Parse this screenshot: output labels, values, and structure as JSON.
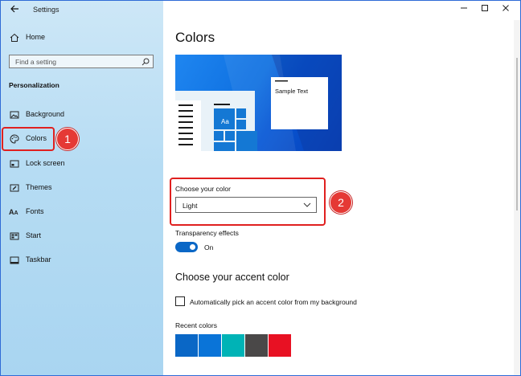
{
  "window": {
    "title": "Settings",
    "back_icon": "arrow-left-icon",
    "minimize_icon": "minimize-icon",
    "maximize_icon": "maximize-icon",
    "close_icon": "close-icon"
  },
  "sidebar": {
    "home_label": "Home",
    "search_placeholder": "Find a setting",
    "section_title": "Personalization",
    "items": [
      {
        "label": "Background",
        "icon": "picture-icon"
      },
      {
        "label": "Colors",
        "icon": "palette-icon",
        "selected": true
      },
      {
        "label": "Lock screen",
        "icon": "lock-screen-icon"
      },
      {
        "label": "Themes",
        "icon": "brush-icon"
      },
      {
        "label": "Fonts",
        "icon": "font-icon"
      },
      {
        "label": "Start",
        "icon": "start-icon"
      },
      {
        "label": "Taskbar",
        "icon": "taskbar-icon"
      }
    ]
  },
  "main": {
    "title": "Colors",
    "preview": {
      "sample_text": "Sample Text",
      "tile_label": "Aa"
    },
    "choose_color_label": "Choose your color",
    "choose_color_value": "Light",
    "transparency_label": "Transparency effects",
    "transparency_state": "On",
    "accent_heading": "Choose your accent color",
    "auto_pick_label": "Automatically pick an accent color from my background",
    "recent_colors_label": "Recent colors",
    "recent_colors": [
      "#0a67c6",
      "#0a74d8",
      "#00b3b6",
      "#4a4848",
      "#e81123"
    ]
  },
  "annotations": {
    "badge_1": "1",
    "badge_2": "2",
    "highlight_color": "#e0201f"
  }
}
